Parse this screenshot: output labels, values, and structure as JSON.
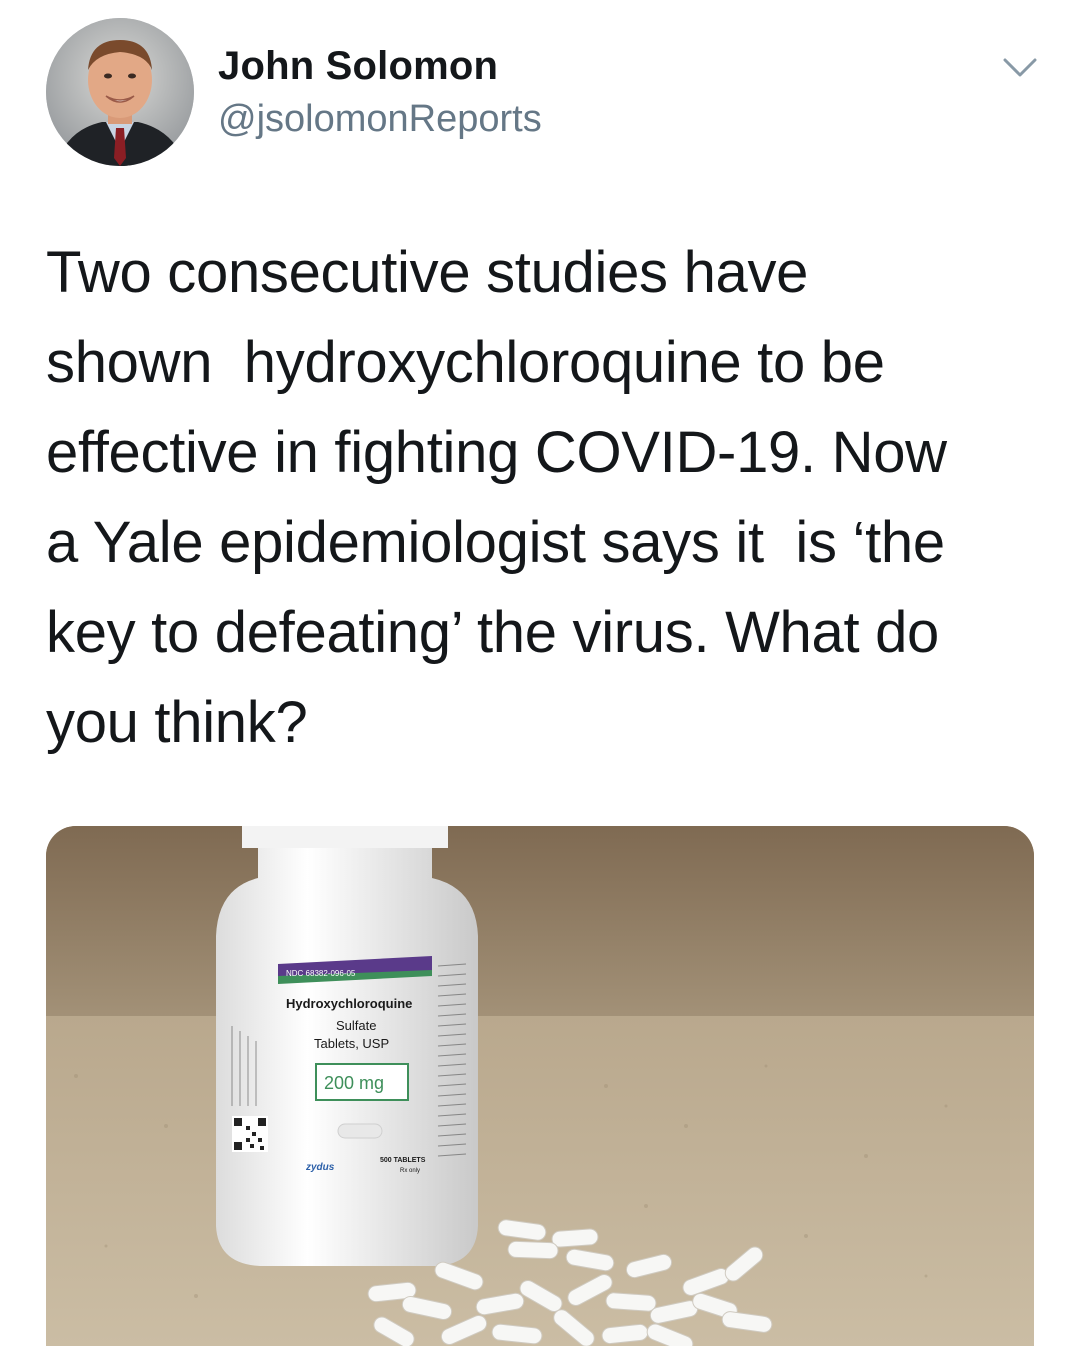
{
  "tweet": {
    "author": {
      "name": "John Solomon",
      "handle": "@jsolomonReports"
    },
    "text": "Two consecutive studies have\nshown  hydroxychloroquine to be\neffective in fighting COVID-19. Now\na Yale epidemiologist says it  is ‘the\nkey to defeating’ the virus. What do\nyou think?",
    "menu_icon": "chevron-down-icon",
    "media": {
      "label": {
        "ndc": "NDC 68382-096-05",
        "drug_line1": "Hydroxychloroquine",
        "drug_line2": "Sulfate",
        "drug_line3": "Tablets, USP",
        "strength": "200 mg",
        "brand": "zydus",
        "count": "500 TABLETS",
        "rx": "Rx only"
      }
    }
  }
}
